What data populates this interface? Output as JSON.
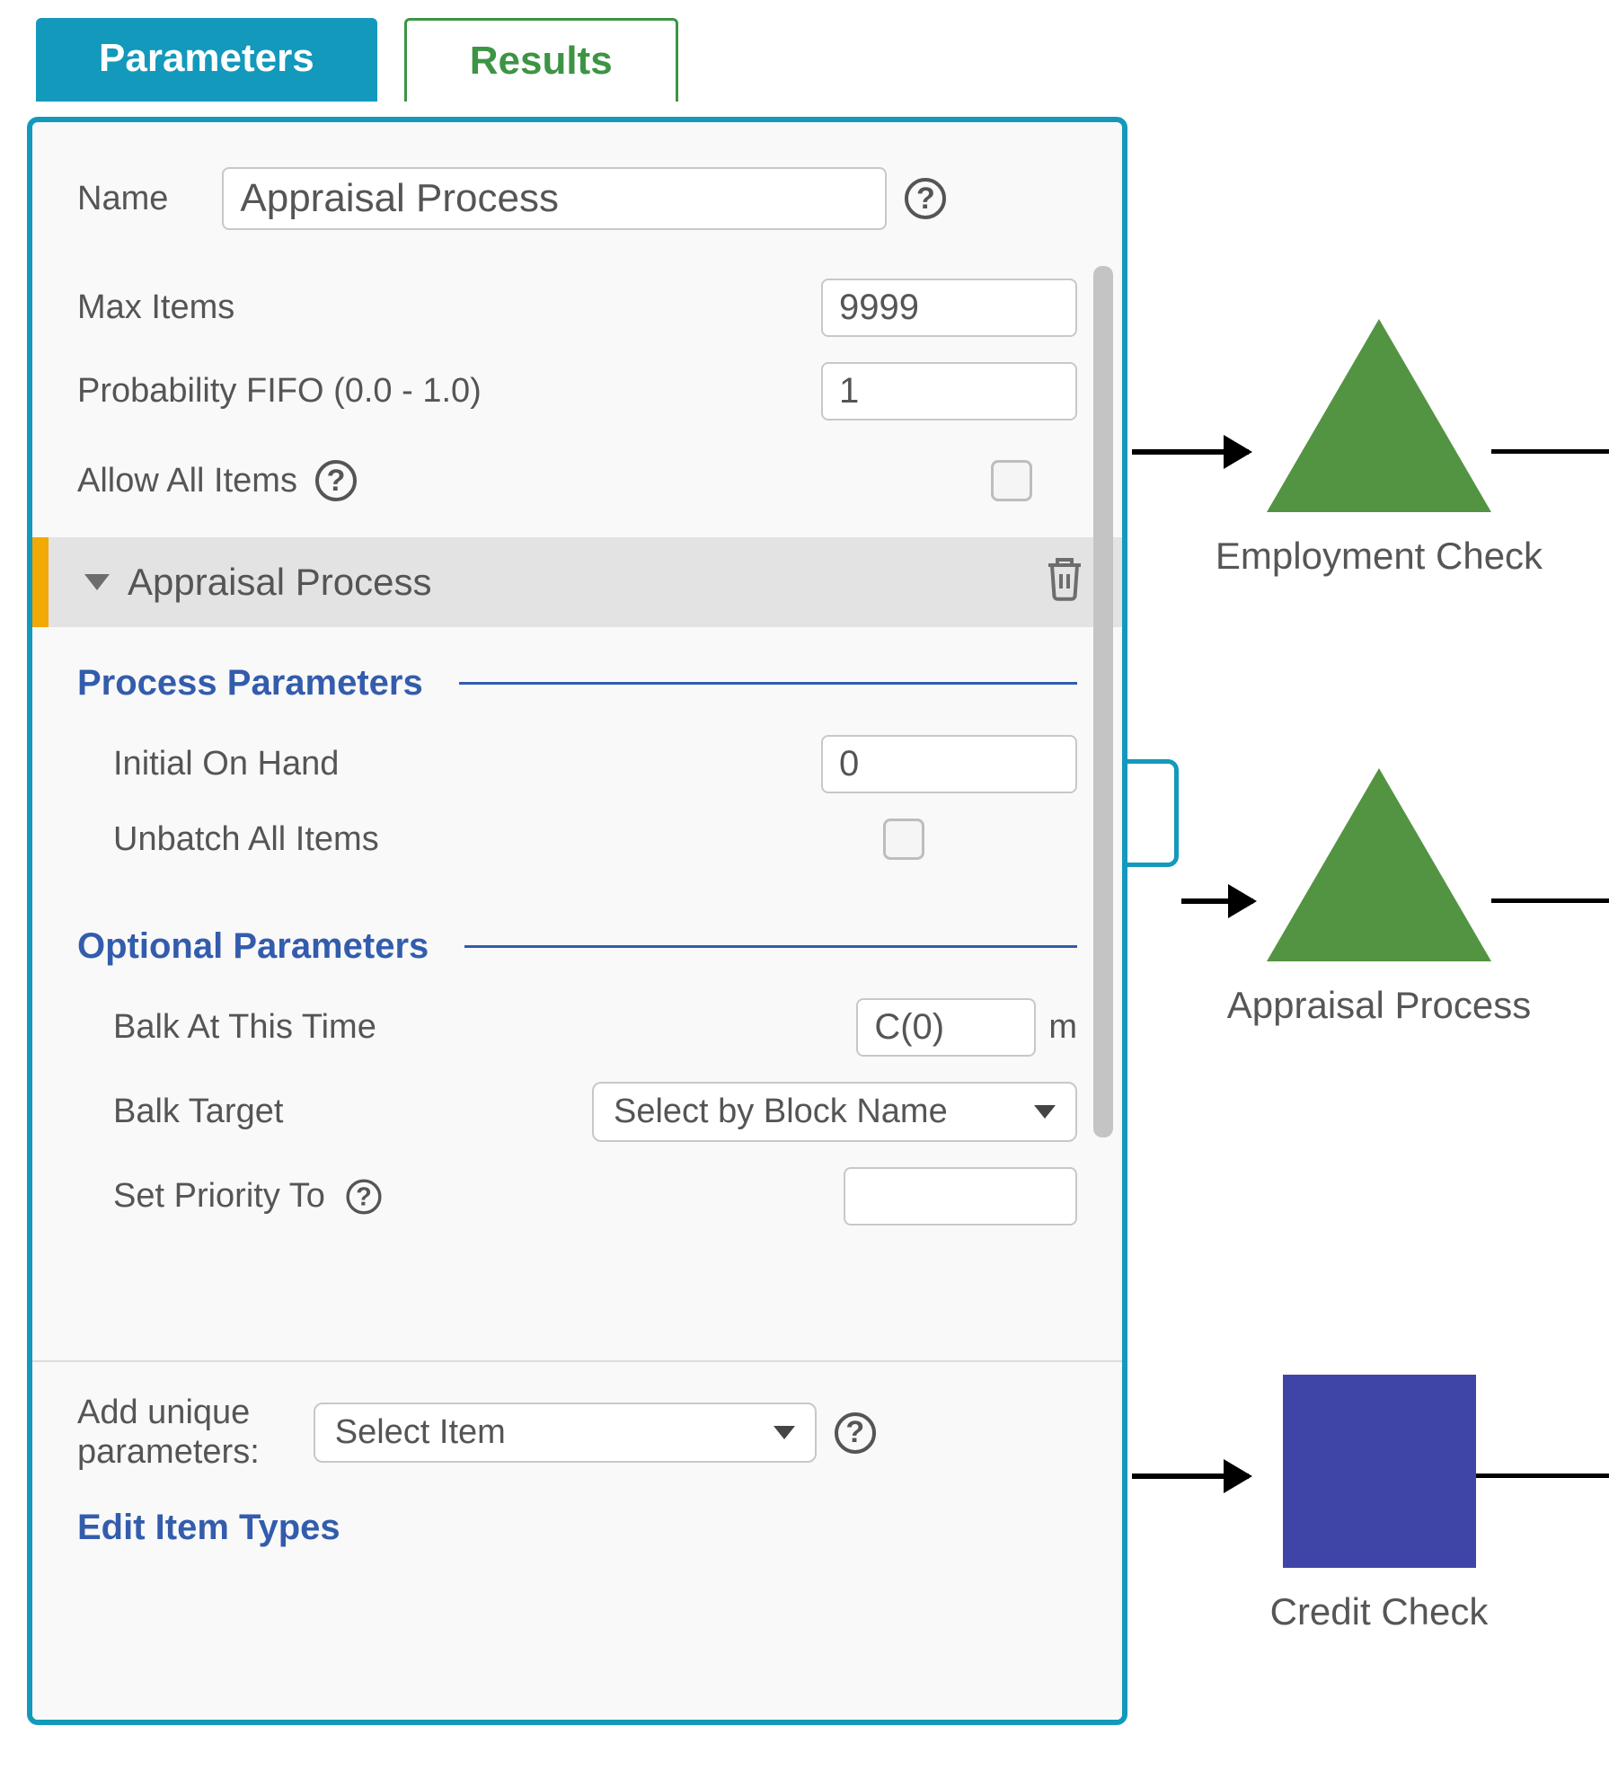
{
  "tabs": {
    "parameters": "Parameters",
    "results": "Results"
  },
  "panel": {
    "name_label": "Name",
    "name_value": "Appraisal Process",
    "max_items_label": "Max Items",
    "max_items_value": "9999",
    "prob_fifo_label": "Probability FIFO (0.0 - 1.0)",
    "prob_fifo_value": "1",
    "allow_all_label": "Allow All Items",
    "item_bar_title": "Appraisal Process",
    "section_process": "Process Parameters",
    "initial_on_hand_label": "Initial On Hand",
    "initial_on_hand_value": "0",
    "unbatch_label": "Unbatch All Items",
    "section_optional": "Optional Parameters",
    "balk_time_label": "Balk At This Time",
    "balk_time_value": "C(0)",
    "balk_time_unit": "m",
    "balk_target_label": "Balk Target",
    "balk_target_value": "Select by Block Name",
    "set_priority_label": "Set Priority To",
    "set_priority_value": ""
  },
  "footer": {
    "add_unique_label_line1": "Add unique",
    "add_unique_label_line2": "parameters:",
    "add_unique_select": "Select Item",
    "edit_item_types": "Edit Item Types"
  },
  "diagram": {
    "nodes": [
      {
        "label": "Employment Check"
      },
      {
        "label": "Appraisal Process"
      },
      {
        "label": "Credit Check"
      }
    ]
  }
}
